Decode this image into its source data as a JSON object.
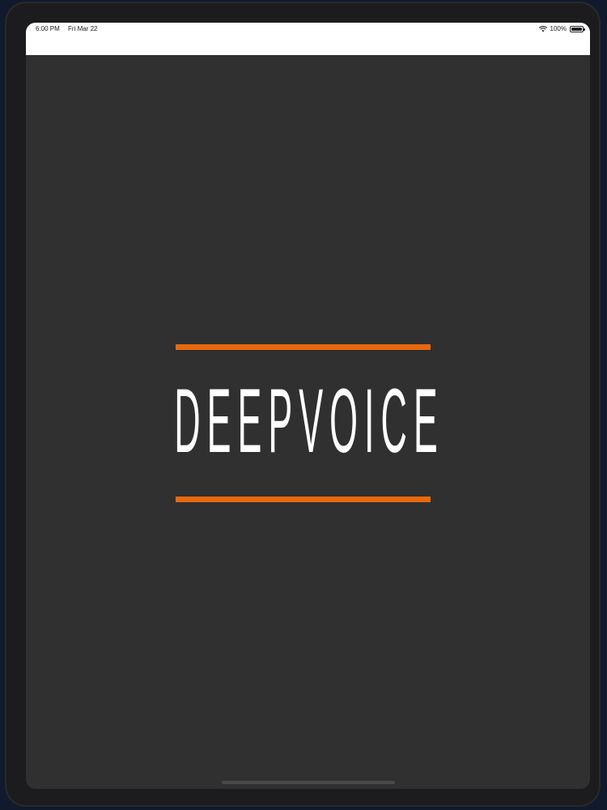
{
  "status_bar": {
    "time": "6:00 PM",
    "date": "Fri Mar 22",
    "battery": "100%",
    "wifi_icon": "wifi-icon",
    "battery_icon": "battery-icon"
  },
  "splash": {
    "logo_text": "DEEPVOICE",
    "accent_color": "#e8690e",
    "background_color": "#303031"
  }
}
